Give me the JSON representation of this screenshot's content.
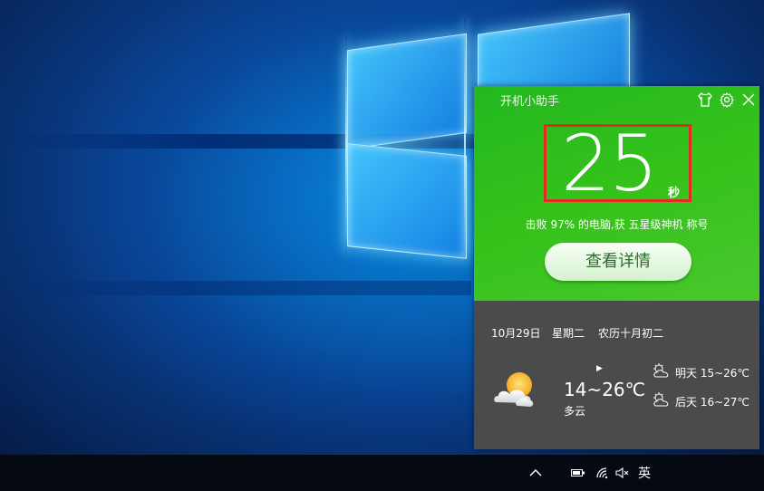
{
  "widget": {
    "title": "开机小助手",
    "seconds": "25",
    "seconds_unit": "秒",
    "summary": "击败 97% 的电脑,获 五星级神机 称号",
    "detail_button": "查看详情"
  },
  "weather": {
    "date": "10月29日",
    "weekday": "星期二",
    "lunar": "农历十月初二",
    "today_temp": "14~26℃",
    "today_desc": "多云",
    "forecast": [
      {
        "day": "明天",
        "temp": "15~26℃",
        "icon": "cloudy-sun-icon"
      },
      {
        "day": "后天",
        "temp": "16~27℃",
        "icon": "cloudy-sun-icon"
      }
    ]
  },
  "taskbar": {
    "ime_label": "英",
    "tray_icons": [
      "chevron-up-icon",
      "battery-icon",
      "wifi-icon",
      "speaker-muted-icon"
    ]
  },
  "colors": {
    "widget_green": "#2fbd1e",
    "highlight_red": "#e52a1e",
    "weather_bg": "#4b4b4b"
  }
}
